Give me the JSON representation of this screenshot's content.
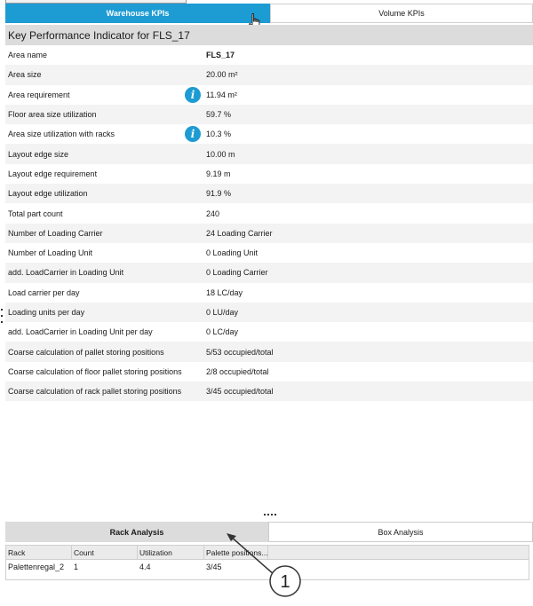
{
  "tabs": {
    "warehouse_kpis": "Warehouse KPIs",
    "volume_kpis": "Volume KPIs"
  },
  "kpi": {
    "header": "Key Performance Indicator for FLS_17",
    "rows": [
      {
        "label": "Area name",
        "value": "FLS_17"
      },
      {
        "label": "Area size",
        "value": "20.00 m²"
      },
      {
        "label": "Area requirement",
        "value": "11.94 m²"
      },
      {
        "label": "Floor area size utilization",
        "value": "59.7 %"
      },
      {
        "label": "Area size utilization with racks",
        "value": "10.3 %"
      },
      {
        "label": "Layout edge size",
        "value": "10.00 m"
      },
      {
        "label": "Layout edge requirement",
        "value": "9.19 m"
      },
      {
        "label": "Layout edge utilization",
        "value": "91.9 %"
      },
      {
        "label": "Total part count",
        "value": "240"
      },
      {
        "label": "Number of Loading Carrier",
        "value": "24 Loading Carrier"
      },
      {
        "label": "Number of Loading Unit",
        "value": "0 Loading Unit"
      },
      {
        "label": "add. LoadCarrier in Loading Unit",
        "value": "0 Loading Carrier"
      },
      {
        "label": "Load carrier per day",
        "value": "18 LC/day"
      },
      {
        "label": "Loading units per day",
        "value": "0 LU/day"
      },
      {
        "label": "add. LoadCarrier in Loading Unit per day",
        "value": "0 LC/day"
      },
      {
        "label": "Coarse calculation of pallet storing positions",
        "value": "5/53 occupied/total"
      },
      {
        "label": "Coarse calculation of floor pallet storing positions",
        "value": "2/8 occupied/total"
      },
      {
        "label": "Coarse calculation of rack pallet storing positions",
        "value": "3/45 occupied/total"
      }
    ],
    "info_icon_glyph": "i"
  },
  "bottom_tabs": {
    "rack_analysis": "Rack Analysis",
    "box_analysis": "Box Analysis"
  },
  "rack_table": {
    "columns": [
      "Rack",
      "Count",
      "Utilization",
      "Palette positions..."
    ],
    "rows": [
      [
        "Palettenregal_2",
        "1",
        "4.4",
        "3/45"
      ]
    ]
  },
  "callout": {
    "number": "1"
  },
  "colors": {
    "accent": "#1d9bd3",
    "header_gray": "#dcdcdc"
  }
}
